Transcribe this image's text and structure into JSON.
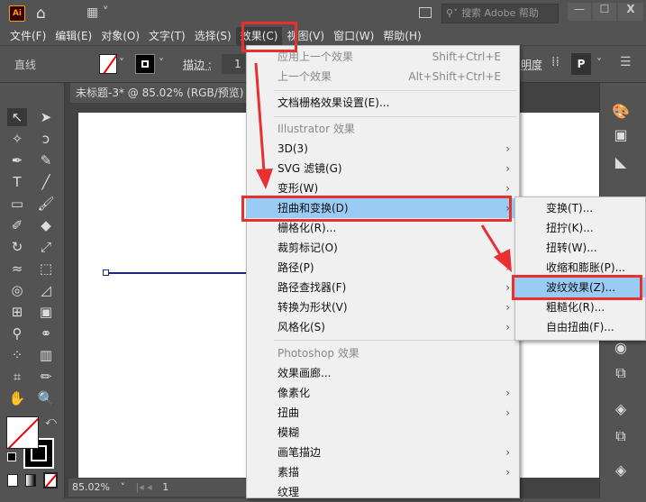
{
  "titlebar": {
    "app_logo": "Ai",
    "search_placeholder": "搜索 Adobe 帮助",
    "minimize": "—",
    "maximize": "☐",
    "close": "X"
  },
  "menubar": [
    "文件(F)",
    "编辑(E)",
    "对象(O)",
    "文字(T)",
    "选择(S)",
    "效果(C)",
    "视图(V)",
    "窗口(W)",
    "帮助(H)"
  ],
  "control": {
    "object_type": "直线",
    "stroke_label": "描边 :",
    "stroke_value": "1",
    "opacity_label": "明度"
  },
  "document": {
    "tab_title": "未标题-3* @ 85.02% (RGB/预览)",
    "zoom": "85.02%",
    "artboard": "1"
  },
  "effect_menu": {
    "apply_last": {
      "label": "应用上一个效果",
      "shortcut": "Shift+Ctrl+E"
    },
    "last": {
      "label": "上一个效果",
      "shortcut": "Alt+Shift+Ctrl+E"
    },
    "doc_raster": "文档栅格效果设置(E)...",
    "illustrator_header": "Illustrator 效果",
    "illustrator_items": [
      {
        "label": "3D(3)",
        "sub": true
      },
      {
        "label": "SVG 滤镜(G)",
        "sub": true
      },
      {
        "label": "变形(W)",
        "sub": true
      },
      {
        "label": "扭曲和变换(D)",
        "sub": true
      },
      {
        "label": "栅格化(R)...",
        "sub": false
      },
      {
        "label": "裁剪标记(O)",
        "sub": false
      },
      {
        "label": "路径(P)",
        "sub": true
      },
      {
        "label": "路径查找器(F)",
        "sub": true
      },
      {
        "label": "转换为形状(V)",
        "sub": true
      },
      {
        "label": "风格化(S)",
        "sub": true
      }
    ],
    "photoshop_header": "Photoshop 效果",
    "photoshop_items": [
      {
        "label": "效果画廊...",
        "sub": false
      },
      {
        "label": "像素化",
        "sub": true
      },
      {
        "label": "扭曲",
        "sub": true
      },
      {
        "label": "模糊",
        "sub": false
      },
      {
        "label": "画笔描边",
        "sub": true
      },
      {
        "label": "素描",
        "sub": true
      },
      {
        "label": "纹理",
        "sub": false
      }
    ]
  },
  "submenu": [
    "变换(T)...",
    "扭拧(K)...",
    "扭转(W)...",
    "收缩和膨胀(P)...",
    "波纹效果(Z)...",
    "粗糙化(R)...",
    "自由扭曲(F)..."
  ],
  "colors": {
    "highlight": "#99cbf5",
    "annotation": "#e8302f",
    "ui_bg": "#535353"
  }
}
